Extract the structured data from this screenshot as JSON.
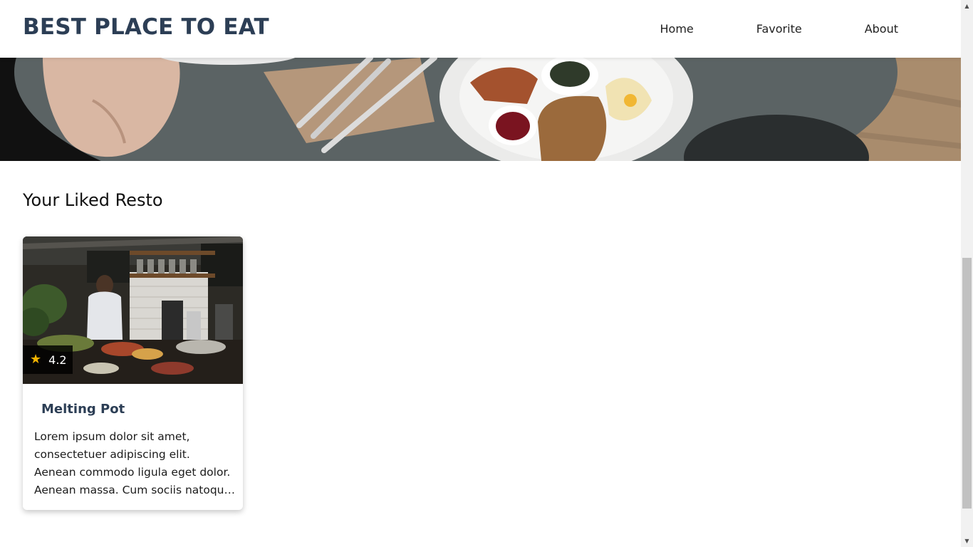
{
  "header": {
    "brand": "BEST PLACE TO EAT",
    "nav": [
      "Home",
      "Favorite",
      "About"
    ]
  },
  "main": {
    "section_title": "Your Liked Resto",
    "restaurants": [
      {
        "name": "Melting Pot",
        "rating": "4.2",
        "description": "Lorem ipsum dolor sit amet, consectetuer adipiscing elit. Aenean commodo ligula eget dolor. Aenean massa. Cum sociis natoque penatibus et magnis dis parturient montes."
      }
    ]
  },
  "colors": {
    "brand": "#2c3e55",
    "star": "#f4b400"
  },
  "icons": {
    "rating": "star-icon",
    "scroll_up": "arrow-up-icon",
    "scroll_down": "arrow-down-icon"
  }
}
